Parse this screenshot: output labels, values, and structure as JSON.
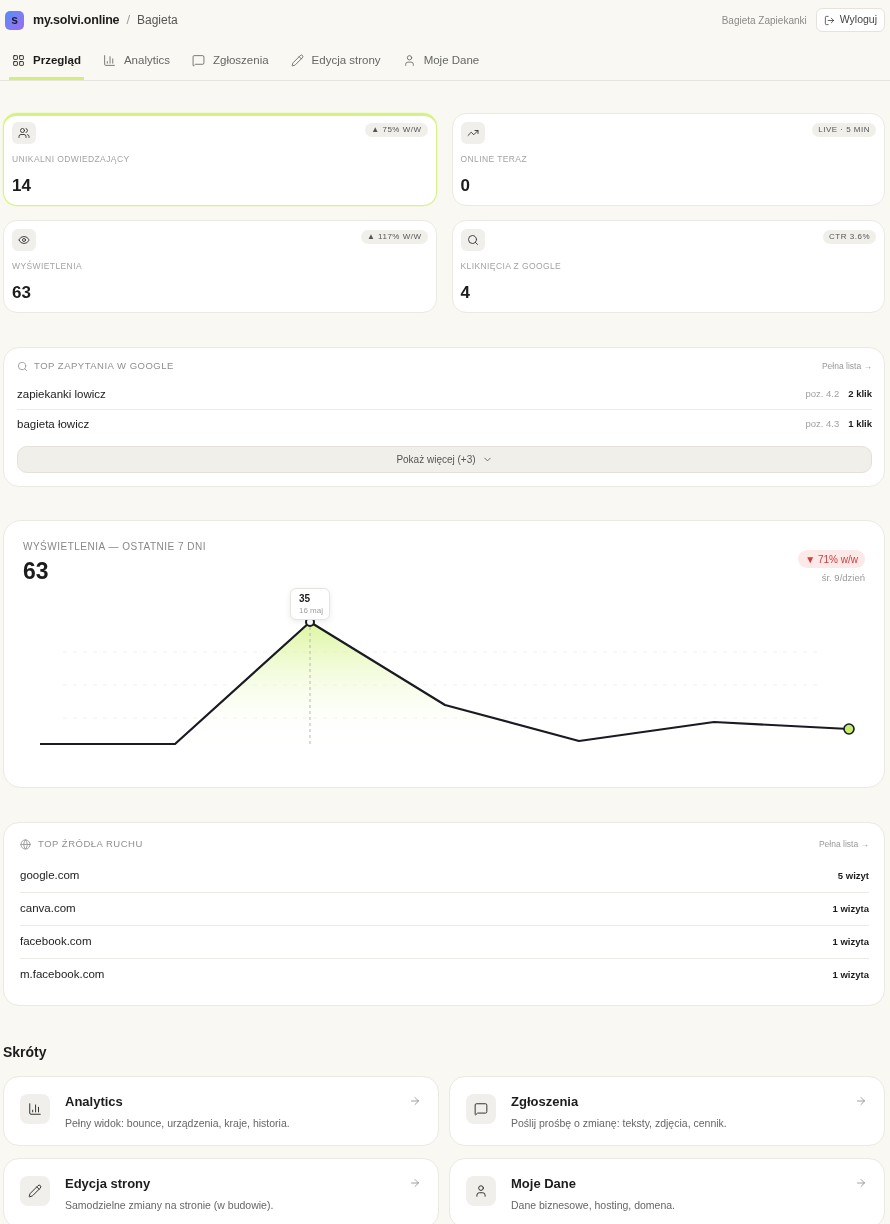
{
  "header": {
    "logo_letter": "s",
    "site": "my.solvi.online",
    "separator": "/",
    "page": "Bagieta",
    "user": "Bagieta Zapiekanki",
    "logout_label": "Wyloguj"
  },
  "tabs": [
    {
      "label": "Przegląd",
      "selected": true
    },
    {
      "label": "Analytics",
      "selected": false
    },
    {
      "label": "Zgłoszenia",
      "selected": false
    },
    {
      "label": "Edycja strony",
      "selected": false
    },
    {
      "label": "Moje Dane",
      "selected": false
    }
  ],
  "stats": [
    {
      "label": "UNIKALNI ODWIEDZAJĄCY",
      "value": "14",
      "badge": "▲ 75% W/W",
      "highlighted": true
    },
    {
      "label": "ONLINE TERAZ",
      "value": "0",
      "badge": "LIVE · 5 MIN",
      "highlighted": false
    },
    {
      "label": "WYŚWIETLENIA",
      "value": "63",
      "badge": "▲ 117% W/W",
      "highlighted": false
    },
    {
      "label": "KLIKNIĘCIA Z GOOGLE",
      "value": "4",
      "badge": "CTR 3.6%",
      "highlighted": false
    }
  ],
  "queries": {
    "title": "TOP ZAPYTANIA W GOOGLE",
    "link": "Pełna lista →",
    "rows": [
      {
        "query": "zapiekanki lowicz",
        "position": "poz. 4.2",
        "clicks": "2 klik"
      },
      {
        "query": "bagieta łowicz",
        "position": "poz. 4.3",
        "clicks": "1 klik"
      }
    ],
    "more_button": "Pokaż więcej (+3)"
  },
  "views_chart": {
    "title": "WYŚWIETLENIA — OSTATNIE 7 DNI",
    "total": "63",
    "change": "▼ 71% w/w",
    "average": "śr. 9/dzień",
    "tooltip": {
      "value": "35",
      "date": "16 maj"
    }
  },
  "sources": {
    "title": "TOP ŹRÓDŁA RUCHU",
    "link": "Pełna lista →",
    "rows": [
      {
        "domain": "google.com",
        "visits": "5 wizyt"
      },
      {
        "domain": "canva.com",
        "visits": "1 wizyta"
      },
      {
        "domain": "facebook.com",
        "visits": "1 wizyta"
      },
      {
        "domain": "m.facebook.com",
        "visits": "1 wizyta"
      }
    ]
  },
  "shortcuts": {
    "title": "Skróty",
    "items": [
      {
        "title": "Analytics",
        "description": "Pełny widok: bounce, urządzenia, kraje, historia."
      },
      {
        "title": "Zgłoszenia",
        "description": "Poślij prośbę o zmianę: teksty, zdjęcia, cennik."
      },
      {
        "title": "Edycja strony",
        "description": "Samodzielne zmiany na stronie (w budowie)."
      },
      {
        "title": "Moje Dane",
        "description": "Dane biznesowe, hosting, domena."
      }
    ]
  }
}
